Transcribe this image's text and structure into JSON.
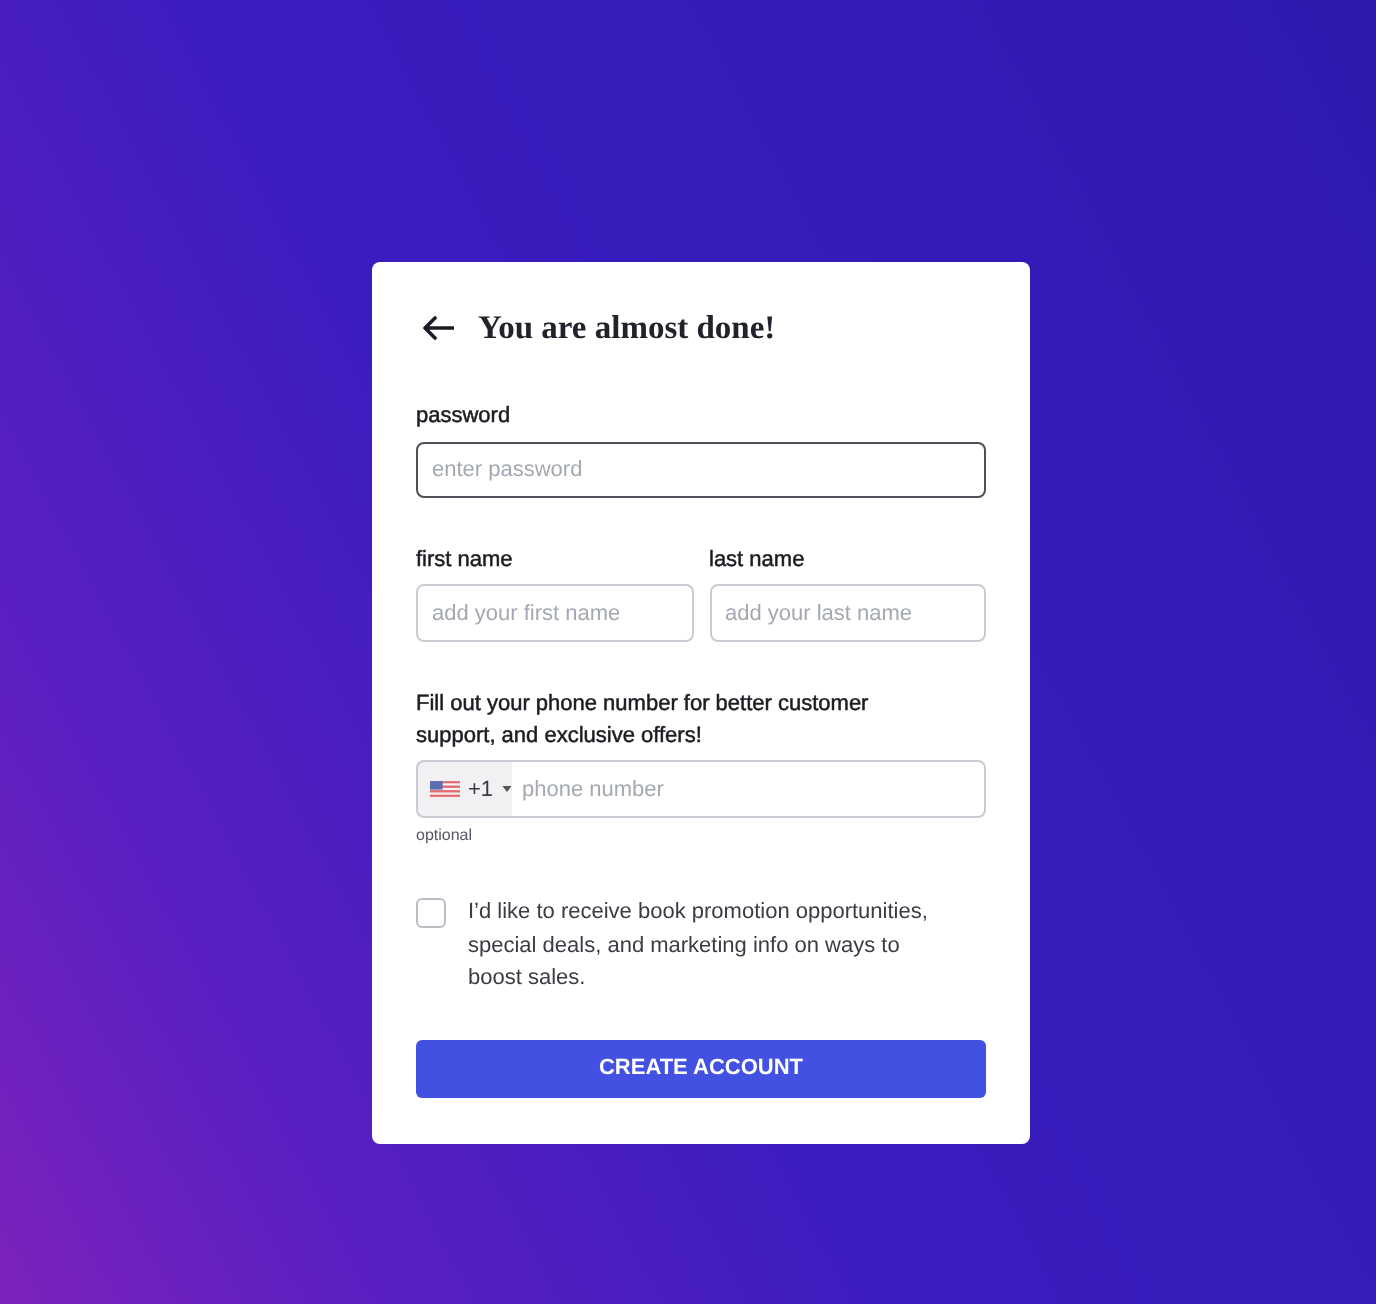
{
  "title": "You are almost done!",
  "password": {
    "label": "password",
    "placeholder": "enter password",
    "focused": true
  },
  "name_fields": [
    {
      "label": "first name",
      "placeholder": "add your first name",
      "focused": false
    },
    {
      "label": "last name",
      "placeholder": "add your last name",
      "focused": false
    }
  ],
  "phone": {
    "prompt": "Fill out your phone number for better customer support, and exclusive offers!",
    "country_code": "+1",
    "placeholder": "phone number",
    "hint": "optional"
  },
  "consent": {
    "text": "I’d like to receive book promotion opportunities, special deals, and marketing info on ways to boost sales.",
    "checked": false
  },
  "submit": {
    "label": "CREATE ACCOUNT"
  }
}
